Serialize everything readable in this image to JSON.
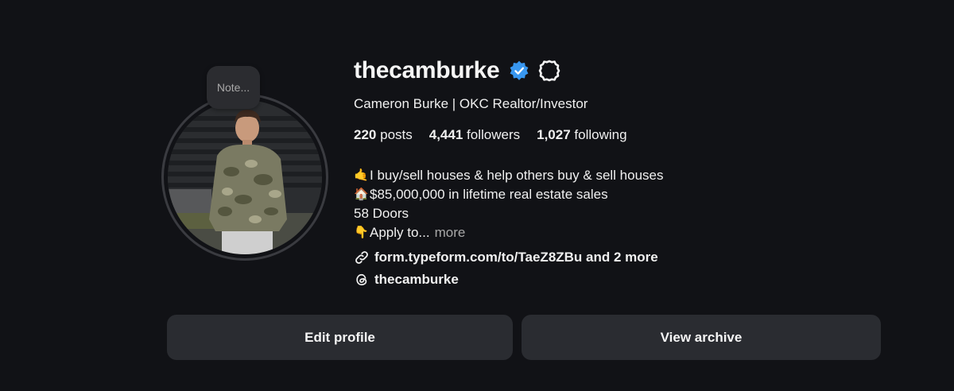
{
  "note": {
    "label": "Note..."
  },
  "profile": {
    "username": "thecamburke",
    "full_name": "Cameron Burke | OKC Realtor/Investor",
    "verified": true
  },
  "stats": {
    "posts_count": "220",
    "posts_label": "posts",
    "followers_count": "4,441",
    "followers_label": "followers",
    "following_count": "1,027",
    "following_label": "following"
  },
  "bio": {
    "lines": [
      {
        "emoji": "🤙",
        "text": "I buy/sell houses & help others buy & sell houses"
      },
      {
        "emoji": "🏠",
        "text": " $85,000,000 in lifetime real estate sales"
      },
      {
        "emoji": "",
        "text": "58 Doors"
      },
      {
        "emoji": "👇",
        "text": "Apply to..."
      }
    ],
    "more_label": "more"
  },
  "links": {
    "website": "form.typeform.com/to/TaeZ8ZBu and 2 more",
    "threads": "thecamburke"
  },
  "buttons": {
    "edit_profile": "Edit profile",
    "view_archive": "View archive"
  },
  "colors": {
    "background": "#111216",
    "button_bg": "#2a2c31",
    "verified_blue": "#3897f0",
    "muted_text": "#a8a8a8"
  },
  "icons": {
    "verified": "verified-badge-icon",
    "settings": "gear-icon",
    "link": "link-icon",
    "threads": "threads-icon"
  }
}
